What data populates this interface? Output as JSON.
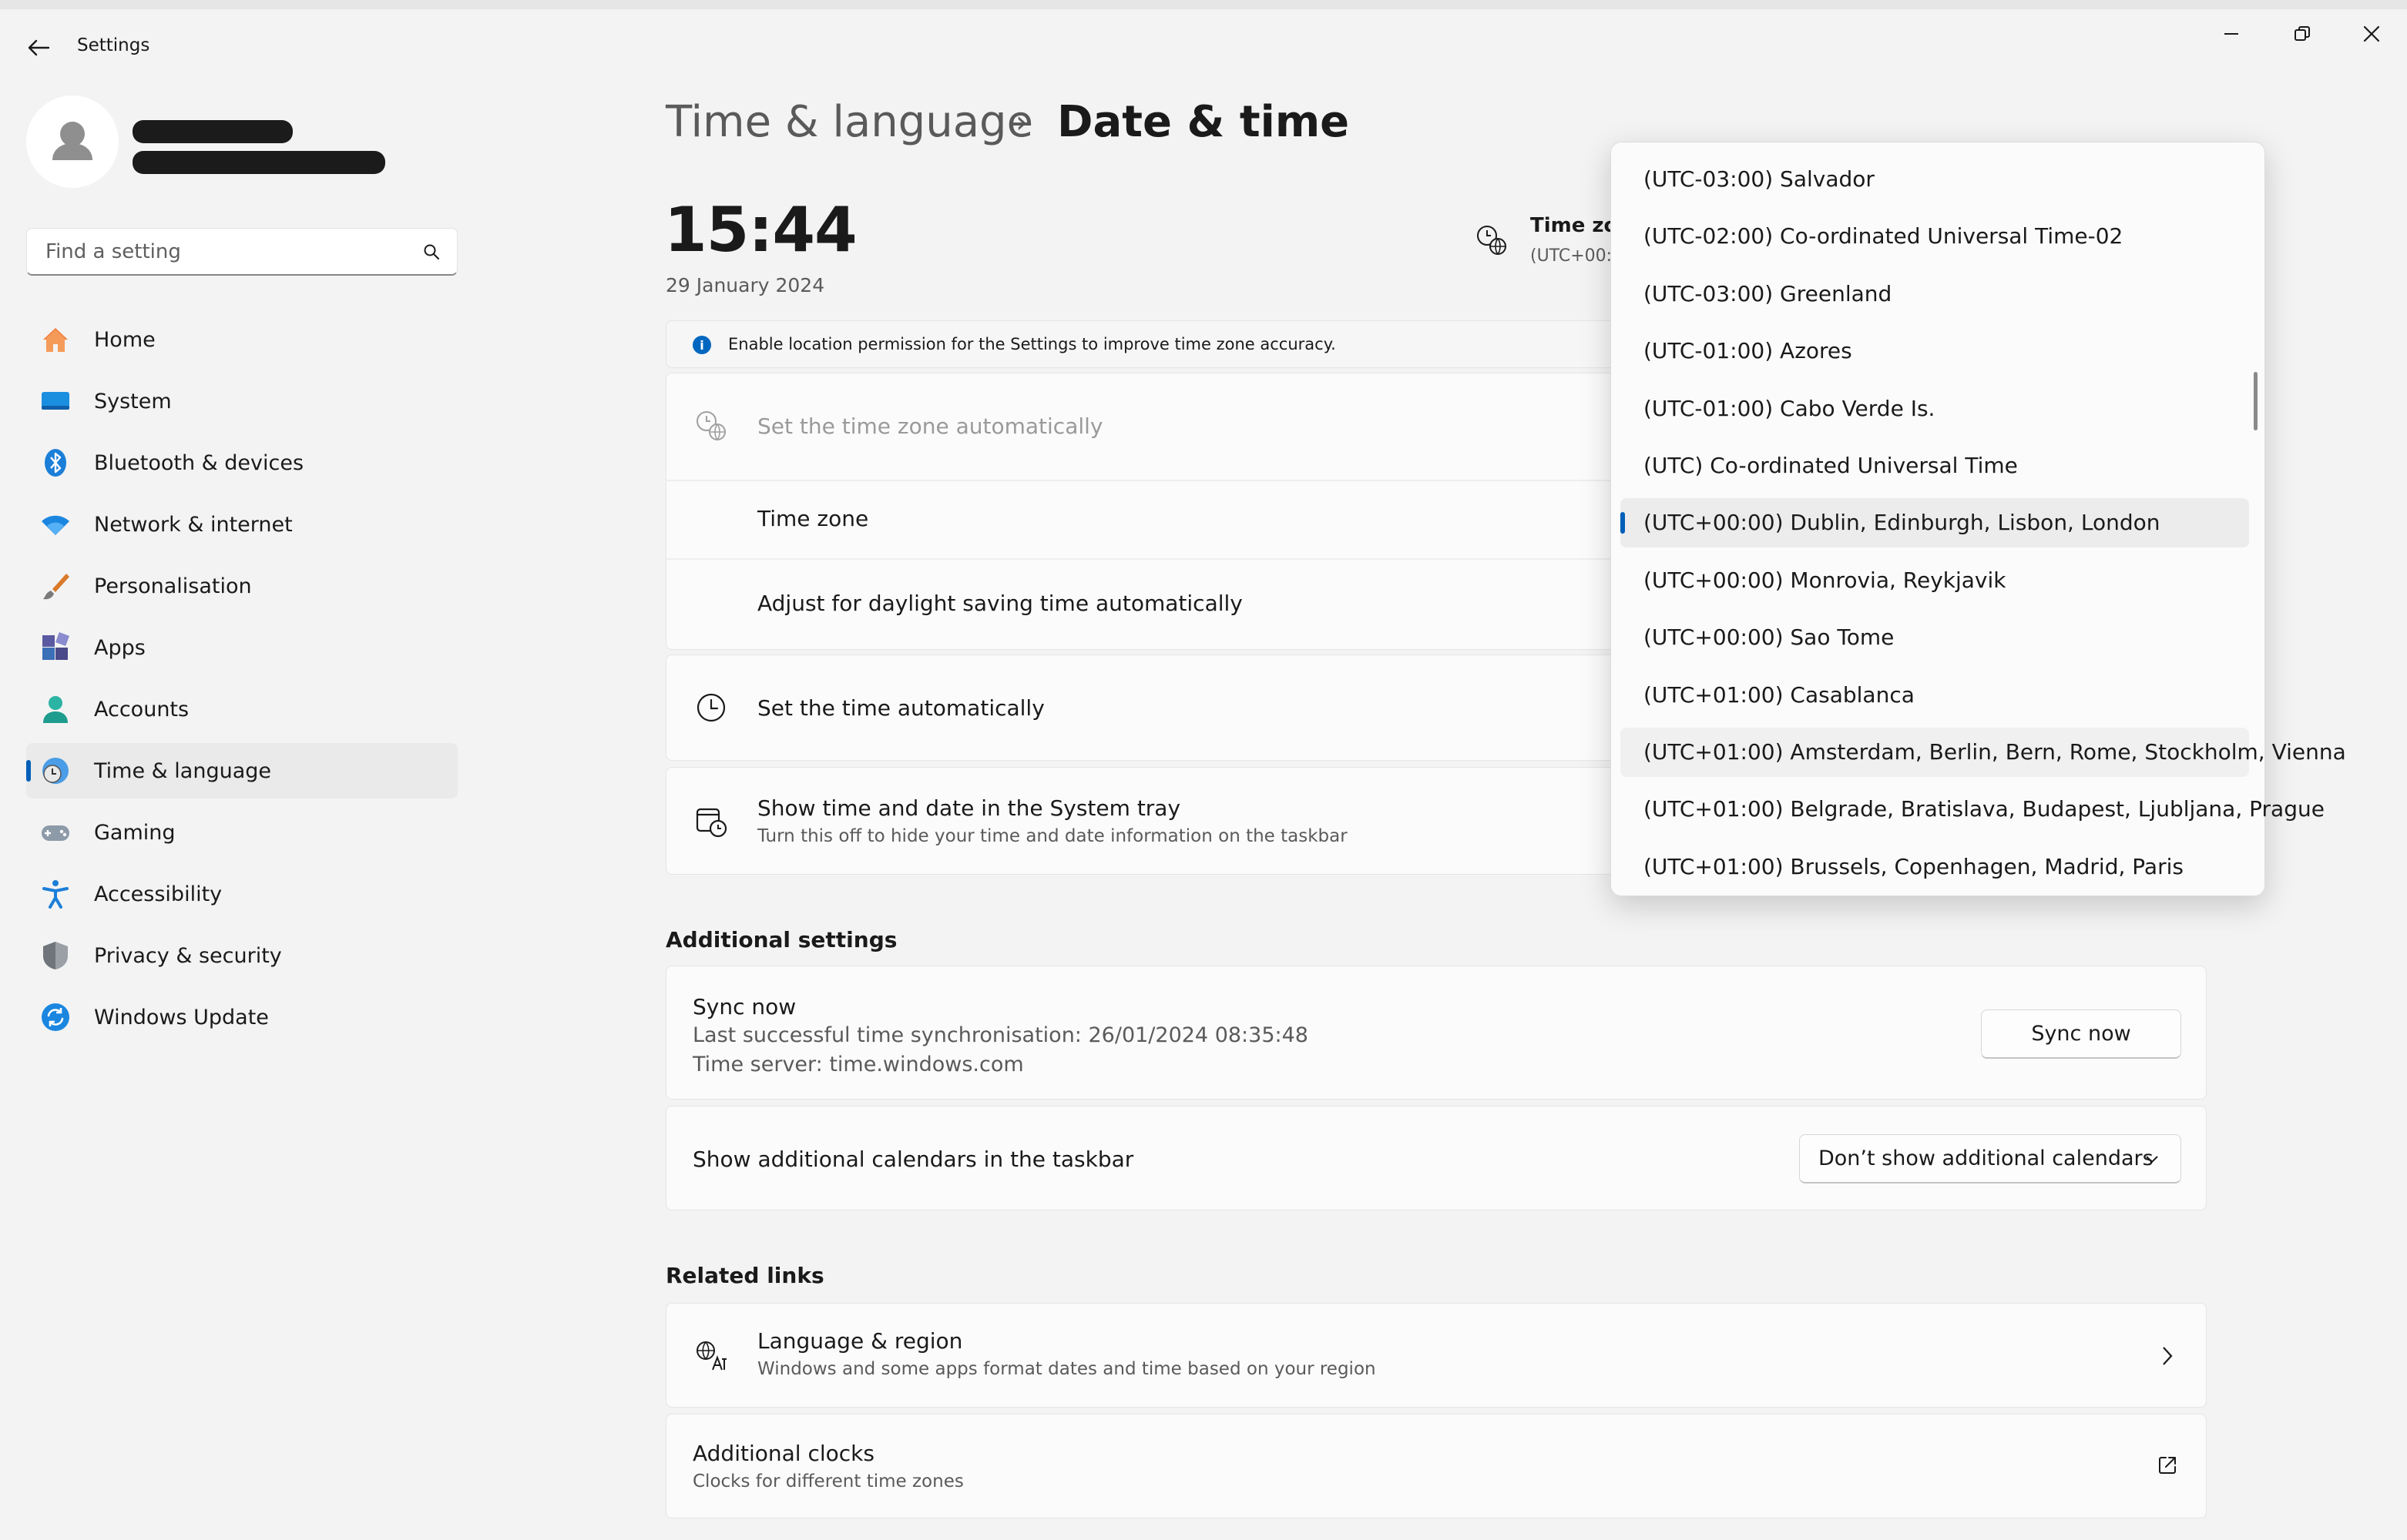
{
  "window": {
    "title": "Settings",
    "back_icon": "arrow-left-icon",
    "minimize_icon": "minimize-icon",
    "restore_icon": "restore-icon",
    "close_icon": "close-icon"
  },
  "sidebar": {
    "search": {
      "placeholder": "Find a setting",
      "value": ""
    },
    "items": [
      {
        "label": "Home",
        "icon": "home-icon",
        "active": false
      },
      {
        "label": "System",
        "icon": "system-icon",
        "active": false
      },
      {
        "label": "Bluetooth & devices",
        "icon": "bluetooth-icon",
        "active": false
      },
      {
        "label": "Network & internet",
        "icon": "wifi-icon",
        "active": false
      },
      {
        "label": "Personalisation",
        "icon": "brush-icon",
        "active": false
      },
      {
        "label": "Apps",
        "icon": "apps-icon",
        "active": false
      },
      {
        "label": "Accounts",
        "icon": "accounts-icon",
        "active": false
      },
      {
        "label": "Time & language",
        "icon": "time-language-icon",
        "active": true
      },
      {
        "label": "Gaming",
        "icon": "gamepad-icon",
        "active": false
      },
      {
        "label": "Accessibility",
        "icon": "accessibility-icon",
        "active": false
      },
      {
        "label": "Privacy & security",
        "icon": "shield-icon",
        "active": false
      },
      {
        "label": "Windows Update",
        "icon": "update-icon",
        "active": false
      }
    ]
  },
  "header": {
    "breadcrumb_parent": "Time & language",
    "separator": "›",
    "page_title": "Date & time"
  },
  "clock": {
    "time": "15:44",
    "date": "29 January 2024"
  },
  "timezone_summary": {
    "label": "Time zo",
    "value": "(UTC+00:"
  },
  "info_banner": {
    "text": "Enable location permission for the Settings to improve time zone accuracy."
  },
  "rows": {
    "auto_timezone": "Set the time zone automatically",
    "time_zone": "Time zone",
    "daylight": "Adjust for daylight saving time automatically",
    "auto_time": "Set the time automatically",
    "tray_title": "Show time and date in the System tray",
    "tray_sub": "Turn this off to hide your time and date information on the taskbar"
  },
  "additional": {
    "heading": "Additional settings",
    "sync_title": "Sync now",
    "sync_last": "Last successful time synchronisation: 26/01/2024 08:35:48",
    "sync_server": "Time server: time.windows.com",
    "sync_button": "Sync now",
    "calendars_label": "Show additional calendars in the taskbar",
    "calendars_value": "Don’t show additional calendars"
  },
  "related": {
    "heading": "Related links",
    "lang_title": "Language & region",
    "lang_sub": "Windows and some apps format dates and time based on your region",
    "clocks_title": "Additional clocks",
    "clocks_sub": "Clocks for different time zones"
  },
  "timezone_dropdown": {
    "selected_index": 6,
    "hover_index": 10,
    "options": [
      "(UTC-03:00) Salvador",
      "(UTC-02:00) Co-ordinated Universal Time-02",
      "(UTC-03:00) Greenland",
      "(UTC-01:00) Azores",
      "(UTC-01:00) Cabo Verde Is.",
      "(UTC) Co-ordinated Universal Time",
      "(UTC+00:00) Dublin, Edinburgh, Lisbon, London",
      "(UTC+00:00) Monrovia, Reykjavik",
      "(UTC+00:00) Sao Tome",
      "(UTC+01:00) Casablanca",
      "(UTC+01:00) Amsterdam, Berlin, Bern, Rome, Stockholm, Vienna",
      "(UTC+01:00) Belgrade, Bratislava, Budapest, Ljubljana, Prague",
      "(UTC+01:00) Brussels, Copenhagen, Madrid, Paris"
    ]
  }
}
